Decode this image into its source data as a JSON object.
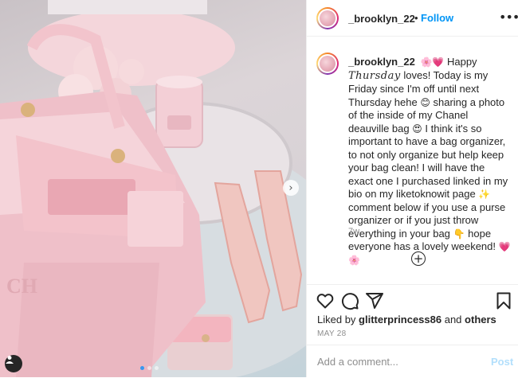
{
  "post": {
    "username": "_brooklyn_22",
    "separator": "•",
    "follow_label": "Follow",
    "more_label": "•••",
    "caption_parts": {
      "p1": "Happy",
      "p2": "Thursday",
      "p3": "loves! Today is my Friday since I'm off until next Thursday hehe",
      "p4": "sharing a photo of the inside of my Chanel deauville bag",
      "p5": "I think it's so important to have a bag organizer, to not only organize but help keep your bag clean! I will have the exact one I purchased linked in my bio on my liketoknowit page",
      "p6": "comment below if you use a purse organizer or if you just throw everything in your bag",
      "p7": "hope everyone has a lovely weekend!"
    },
    "emojis": {
      "after_username": "🌸💗",
      "after_hehe": "😊",
      "after_bag": "😍",
      "after_page": "✨",
      "after_bag2": "👇",
      "end": "💗🌸"
    },
    "time_ago": "7w",
    "add_reply_label": "+",
    "liked_by_prefix": "Liked by",
    "liked_by_user": "glitterprincess86",
    "liked_by_and": "and",
    "liked_by_others": "others",
    "date": "MAY 28",
    "comment_placeholder": "Add a comment...",
    "post_label": "Post"
  },
  "photo": {
    "next_arrow": "›",
    "carousel_count": 3,
    "active_index": 0
  },
  "icons": {
    "like": "heart-icon",
    "comment": "comment-icon",
    "share": "paper-plane-icon",
    "save": "bookmark-icon",
    "user_tag": "person-icon"
  },
  "colors": {
    "link_blue": "#0095f6",
    "muted_text": "#8e8e8e",
    "post_disabled": "#b2dffc"
  }
}
